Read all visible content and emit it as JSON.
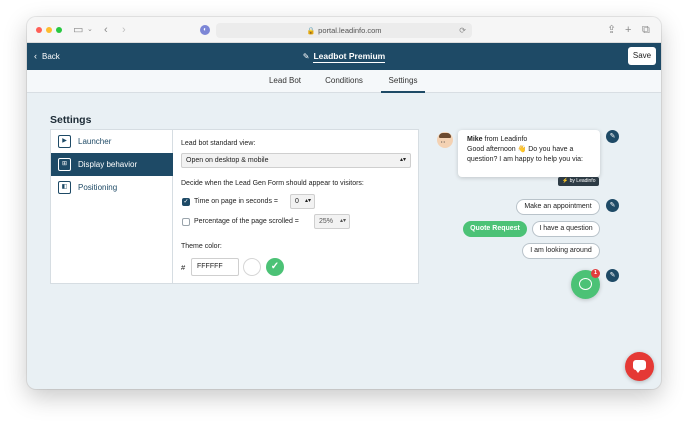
{
  "browser": {
    "url": "portal.leadinfo.com"
  },
  "header": {
    "back_label": "Back",
    "title": "Leadbot Premium",
    "save_label": "Save"
  },
  "tabs": [
    {
      "label": "Lead Bot"
    },
    {
      "label": "Conditions"
    },
    {
      "label": "Settings",
      "active": true
    }
  ],
  "settings": {
    "heading": "Settings",
    "nav": [
      {
        "label": "Launcher",
        "icon": "play-icon"
      },
      {
        "label": "Display behavior",
        "icon": "layout-icon",
        "active": true
      },
      {
        "label": "Positioning",
        "icon": "position-icon"
      }
    ],
    "standard_view_label": "Lead bot standard view:",
    "standard_view_value": "Open on desktop & mobile",
    "decide_label": "Decide when the Lead Gen Form should appear to visitors:",
    "time_label": "Time on page in seconds =",
    "time_checked": true,
    "time_value": "0",
    "percent_label": "Percentage of the page scrolled =",
    "percent_checked": false,
    "percent_value": "25%",
    "theme_label": "Theme color:",
    "hash": "#",
    "theme_value": "FFFFFF"
  },
  "preview": {
    "agent_name": "Mike",
    "agent_from": "from Leadinfo",
    "greeting": "Good afternoon 👋 Do you have a question? I am happy to help you via:",
    "powered_by": "⚡ by Leadinfo",
    "options": [
      "Make an appointment",
      "Quote Request",
      "I have a question",
      "I am looking around"
    ],
    "badge_count": "1"
  },
  "colors": {
    "brand": "#1e4a66",
    "accent_green": "#4cc276",
    "chat_red": "#e53935"
  }
}
